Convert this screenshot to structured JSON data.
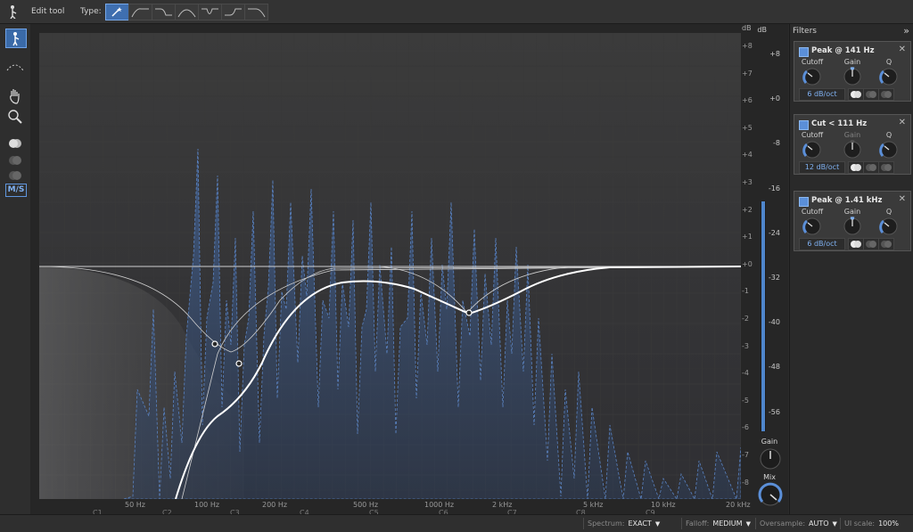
{
  "toolbar": {
    "edit_tool_label": "Edit tool",
    "type_label": "Type:",
    "type_buttons": [
      "wand",
      "highpass",
      "lowpass-shelf",
      "bandpass",
      "notch",
      "shelf",
      "lowpass"
    ]
  },
  "left_tools": [
    "pointer-icon",
    "curve-icon",
    "hand-icon",
    "magnifier-icon",
    "stereo-mid-icon",
    "stereo-left-icon",
    "stereo-right-icon"
  ],
  "left_tools_ms": "M/S",
  "plot": {
    "db_label": "dB",
    "db_ticks": [
      "+8",
      "+7",
      "+6",
      "+5",
      "+4",
      "+3",
      "+2",
      "+1",
      "+0",
      "-1",
      "-2",
      "-3",
      "-4",
      "-5",
      "-6",
      "-7",
      "-8"
    ],
    "freq_labels": [
      "50 Hz",
      "100 Hz",
      "200 Hz",
      "500 Hz",
      "1000 Hz",
      "2 kHz",
      "5 kHz",
      "10 kHz",
      "20 kHz"
    ],
    "note_labels": [
      "C1",
      "C2",
      "C3",
      "C4",
      "C5",
      "C6",
      "C7",
      "C8",
      "C9"
    ]
  },
  "meter": {
    "db_label": "dB",
    "labels": [
      "+8",
      "+0",
      "-8",
      "-16",
      "-24",
      "-32",
      "-40",
      "-48",
      "-56"
    ],
    "level_fraction": 1.0,
    "gain_label": "Gain",
    "mix_label": "Mix"
  },
  "filters_panel": {
    "title": "Filters",
    "chevron": "»",
    "cards": [
      {
        "title": "Peak @ 141 Hz",
        "close": "✕",
        "k1": "Cutoff",
        "k2": "Gain",
        "k3": "Q",
        "k2_dim": false,
        "slope_num": "6",
        "slope_unit": "dB/oct"
      },
      {
        "title": "Cut < 111 Hz",
        "close": "✕",
        "k1": "Cutoff",
        "k2": "Gain",
        "k3": "Q",
        "k2_dim": true,
        "slope_num": "12",
        "slope_unit": "dB/oct"
      },
      {
        "title": "Peak @ 1.41 kHz",
        "close": "✕",
        "k1": "Cutoff",
        "k2": "Gain",
        "k3": "Q",
        "k2_dim": false,
        "slope_num": "6",
        "slope_unit": "dB/oct"
      }
    ]
  },
  "bottombar": {
    "spectrum_label": "Spectrum:",
    "spectrum_value": "EXACT",
    "falloff_label": "Falloff:",
    "falloff_value": "MEDIUM",
    "oversample_label": "Oversample:",
    "oversample_value": "AUTO",
    "uiscale_label": "UI scale:",
    "uiscale_value": "100%"
  },
  "colors": {
    "accent": "#5b8fd8",
    "curve": "#ffffff",
    "spectrum": "#4a6fa8"
  }
}
